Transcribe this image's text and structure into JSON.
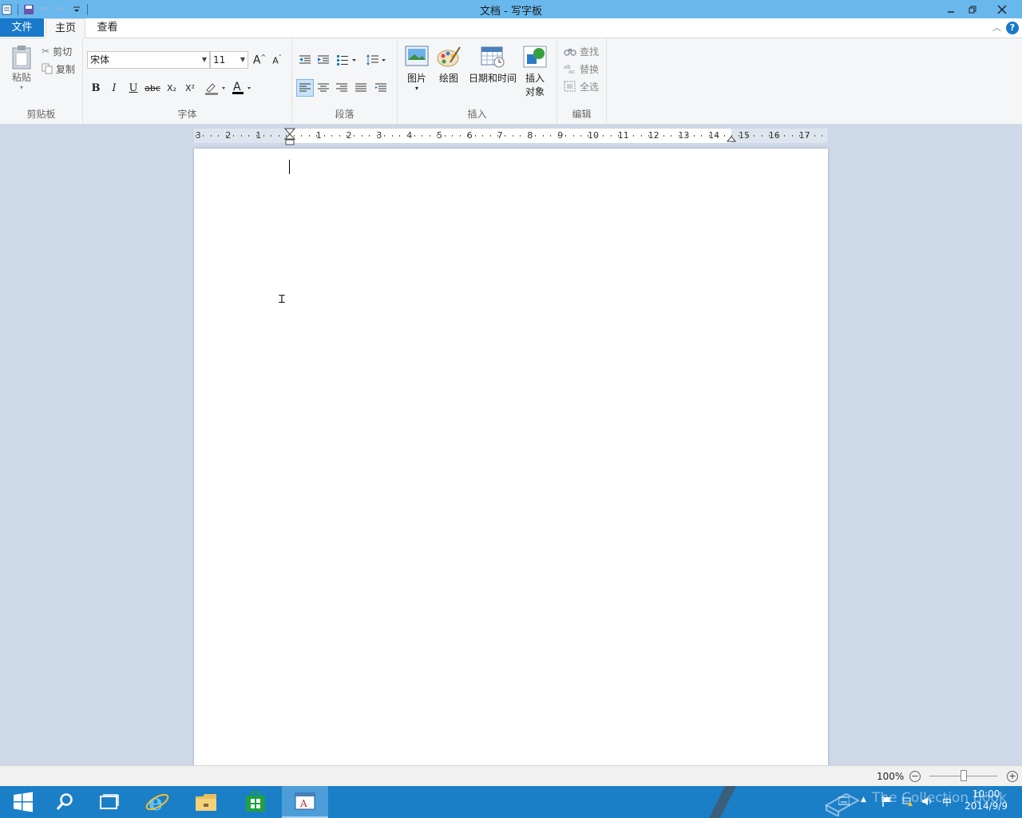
{
  "window": {
    "title": "文档 - 写字板"
  },
  "ribbon_tabs": {
    "file": "文件",
    "home": "主页",
    "view": "查看"
  },
  "clipboard": {
    "paste": "粘贴",
    "cut": "剪切",
    "copy": "复制",
    "group_label": "剪贴板"
  },
  "font": {
    "family": "宋体",
    "size": "11",
    "group_label": "字体",
    "bold": "B",
    "italic": "I",
    "underline": "U",
    "strike": "abc",
    "subscript": "X₂",
    "superscript": "X²",
    "color_letter": "A"
  },
  "paragraph": {
    "group_label": "段落"
  },
  "insert": {
    "picture": "图片",
    "drawing": "绘图",
    "datetime": "日期和时间",
    "object_line1": "插入",
    "object_line2": "对象",
    "group_label": "插入"
  },
  "editing": {
    "find": "查找",
    "replace": "替换",
    "select_all": "全选",
    "group_label": "编辑"
  },
  "ruler": {
    "left": [
      "3",
      "2",
      "1"
    ],
    "right": [
      "1",
      "2",
      "3",
      "4",
      "5",
      "6",
      "7",
      "8",
      "9",
      "10",
      "11",
      "12",
      "13",
      "14",
      "15",
      "16",
      "17"
    ]
  },
  "status": {
    "zoom": "100%"
  },
  "taskbar": {
    "time": "10:00",
    "date": "2014/9/9",
    "watermark": "The Collection Book",
    "ime": "中"
  },
  "colors": {
    "titlebar": "#69b8ed",
    "file_tab": "#1979ca",
    "taskbar": "#1b7fc7",
    "workspace": "#cdd8e8"
  }
}
